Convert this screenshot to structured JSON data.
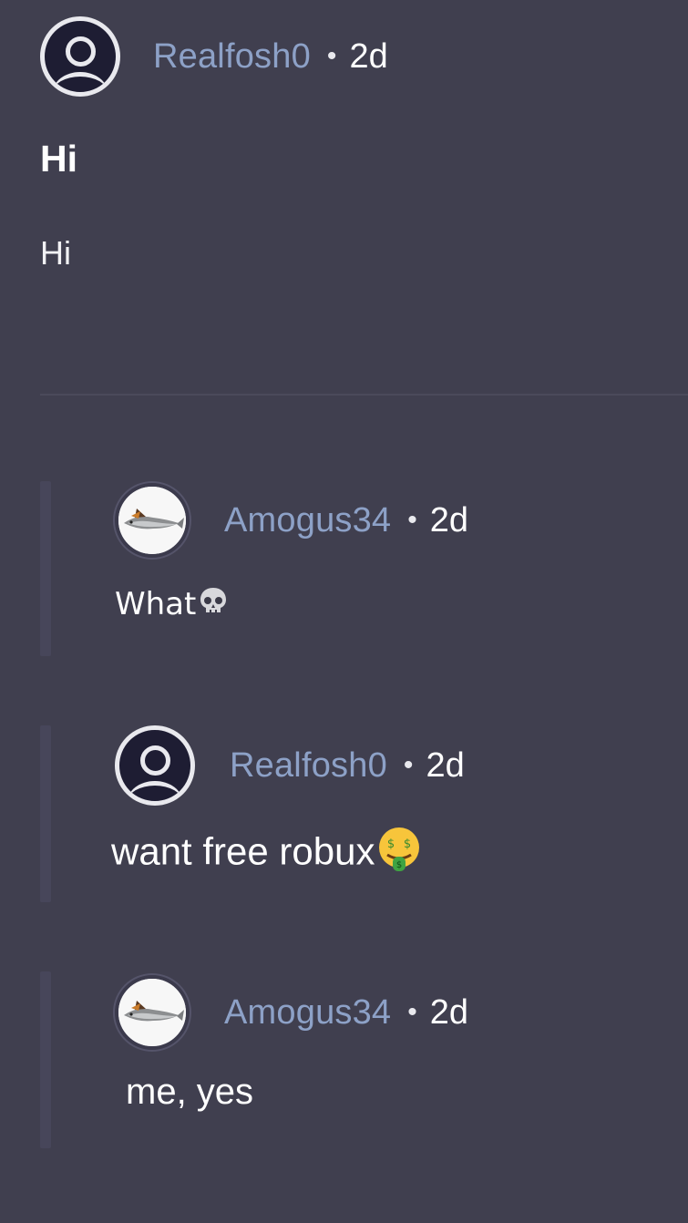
{
  "post": {
    "author": "Realfosh0",
    "separator": "•",
    "time": "2d",
    "title": "Hi",
    "body": "Hi"
  },
  "replies": [
    {
      "author": "Amogus34",
      "separator": "•",
      "time": "2d",
      "text": "What",
      "avatar": "fish-avatar",
      "emoji": "skull-emoji"
    },
    {
      "author": "Realfosh0",
      "separator": "•",
      "time": "2d",
      "text": "want free robux",
      "avatar": "default-user-avatar",
      "emoji": "money-mouth-emoji"
    },
    {
      "author": "Amogus34",
      "separator": "•",
      "time": "2d",
      "text": "me, yes",
      "avatar": "fish-avatar",
      "emoji": ""
    }
  ],
  "colors": {
    "background": "#403f4f",
    "username": "#8da1c7",
    "text": "#ffffff",
    "rail": "#47465a"
  }
}
